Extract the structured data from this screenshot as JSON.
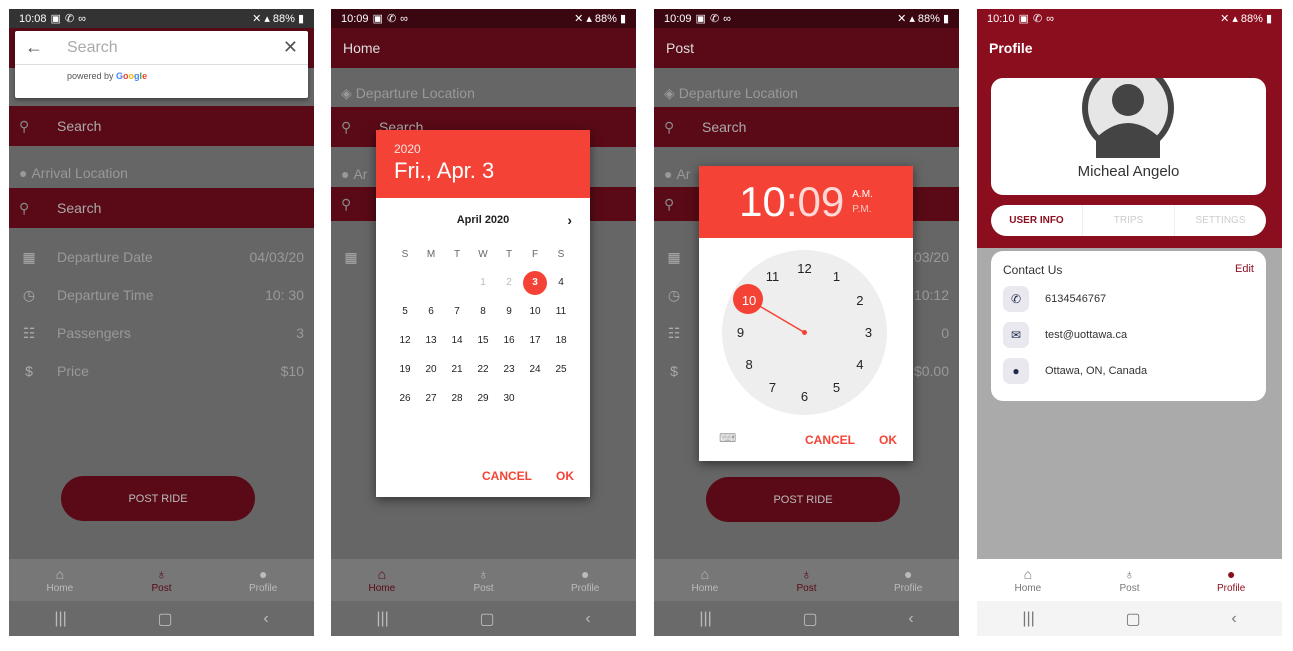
{
  "colors": {
    "accent": "#f44336",
    "brand": "#8b0e1f",
    "dim_brand": "#5a0a16"
  },
  "s1": {
    "time": "10:08",
    "battery": "88%",
    "search": {
      "placeholder": "Search",
      "powered": "powered by ",
      "google": [
        "G",
        "o",
        "o",
        "g",
        "l",
        "e"
      ]
    },
    "arrival_label": "Arrival Location",
    "search2": "Search",
    "search3": "Search",
    "rows": [
      {
        "icon": "calendar-icon",
        "label": "Departure Date",
        "value": "04/03/20"
      },
      {
        "icon": "clock-icon",
        "label": "Departure Time",
        "value": "10: 30"
      },
      {
        "icon": "people-icon",
        "label": "Passengers",
        "value": "3"
      },
      {
        "icon": "dollar-icon",
        "label": "Price",
        "value": "$10"
      }
    ],
    "post_button": "POST RIDE",
    "nav": [
      "Home",
      "Post",
      "Profile"
    ]
  },
  "s2": {
    "time": "10:09",
    "battery": "88%",
    "title": "Home",
    "departure_label": "Departure Location",
    "search": "Search",
    "arrival_partial": "Ar",
    "dialog": {
      "year": "2020",
      "date": "Fri., Apr. 3",
      "month": "April 2020",
      "weekdays": [
        "S",
        "M",
        "T",
        "W",
        "T",
        "F",
        "S"
      ],
      "cancel": "CANCEL",
      "ok": "OK"
    },
    "nav": [
      "Home",
      "Post",
      "Profile"
    ]
  },
  "s3": {
    "time": "10:09",
    "battery": "88%",
    "title": "Post",
    "departure_label": "Departure Location",
    "search": "Search",
    "arrival_partial": "Ar",
    "side_values": [
      "03/20",
      "10:12",
      "0",
      "$0.00"
    ],
    "dialog": {
      "hour": "10",
      "colon": ":",
      "minute": "09",
      "am": "A.M.",
      "pm": "P.M.",
      "cancel": "CANCEL",
      "ok": "OK",
      "numbers": [
        "12",
        "1",
        "2",
        "3",
        "4",
        "5",
        "6",
        "7",
        "8",
        "9",
        "10",
        "11"
      ]
    },
    "post_button": "POST RIDE",
    "nav": [
      "Home",
      "Post",
      "Profile"
    ]
  },
  "s4": {
    "time": "10:10",
    "battery": "88%",
    "title": "Profile",
    "name": "Micheal Angelo",
    "tabs": [
      "USER INFO",
      "TRIPS",
      "SETTINGS"
    ],
    "contact_title": "Contact Us",
    "edit": "Edit",
    "contacts": [
      {
        "icon": "phone-icon",
        "text": "6134546767"
      },
      {
        "icon": "mail-icon",
        "text": "test@uottawa.ca"
      },
      {
        "icon": "location-icon",
        "text": "Ottawa, ON, Canada"
      }
    ],
    "nav": [
      "Home",
      "Post",
      "Profile"
    ]
  }
}
